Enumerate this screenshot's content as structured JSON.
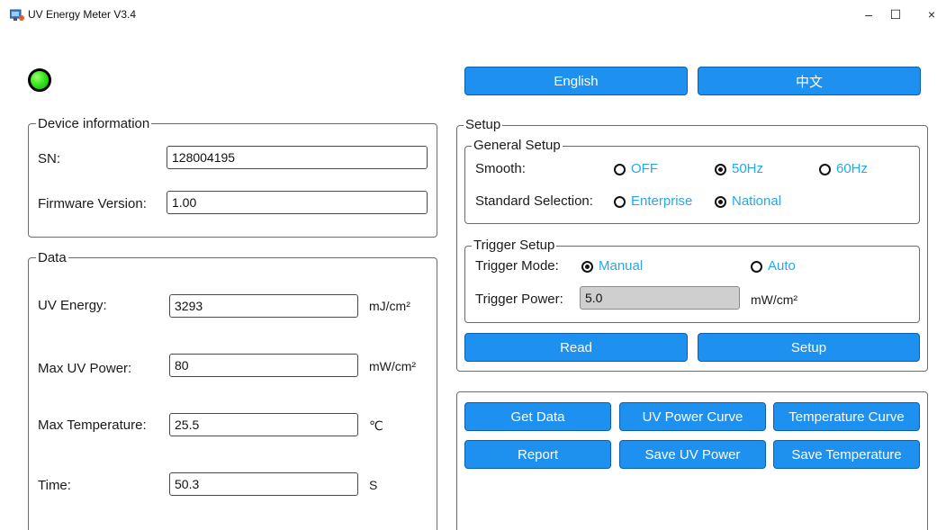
{
  "window": {
    "title": "UV Energy Meter V3.4",
    "minimize_glyph": "–",
    "maximize_glyph": "☐",
    "close_glyph": "×"
  },
  "colors": {
    "button_fill": "#1e90f0",
    "radio_text": "#27a8e8",
    "led": "#35e81f"
  },
  "language": {
    "english_label": "English",
    "chinese_label": "中文"
  },
  "device_info": {
    "title": "Device information",
    "sn_label": "SN:",
    "sn_value": "128004195",
    "firmware_label": "Firmware Version:",
    "firmware_value": "1.00"
  },
  "data": {
    "title": "Data",
    "uv_energy_label": "UV Energy:",
    "uv_energy_value": "3293",
    "uv_energy_unit": "mJ/cm²",
    "max_uv_power_label": "Max UV Power:",
    "max_uv_power_value": "80",
    "max_uv_power_unit": "mW/cm²",
    "max_temp_label": "Max Temperature:",
    "max_temp_value": "25.5",
    "max_temp_unit": "℃",
    "time_label": "Time:",
    "time_value": "50.3",
    "time_unit": "S"
  },
  "setup": {
    "title": "Setup",
    "general": {
      "title": "General Setup",
      "smooth_label": "Smooth:",
      "smooth_options": [
        {
          "label": "OFF",
          "selected": false
        },
        {
          "label": "50Hz",
          "selected": true
        },
        {
          "label": "60Hz",
          "selected": false
        }
      ],
      "standard_label": "Standard Selection:",
      "standard_options": [
        {
          "label": "Enterprise",
          "selected": false
        },
        {
          "label": "National",
          "selected": true
        }
      ]
    },
    "trigger": {
      "title": "Trigger Setup",
      "mode_label": "Trigger Mode:",
      "mode_options": [
        {
          "label": "Manual",
          "selected": true
        },
        {
          "label": "Auto",
          "selected": false
        }
      ],
      "power_label": "Trigger Power:",
      "power_value": "5.0",
      "power_unit": "mW/cm²"
    },
    "read_label": "Read",
    "setup_label": "Setup"
  },
  "actions": {
    "get_data": "Get Data",
    "uv_power_curve": "UV Power Curve",
    "temperature_curve": "Temperature Curve",
    "report": "Report",
    "save_uv_power": "Save UV Power",
    "save_temperature": "Save Temperature"
  }
}
